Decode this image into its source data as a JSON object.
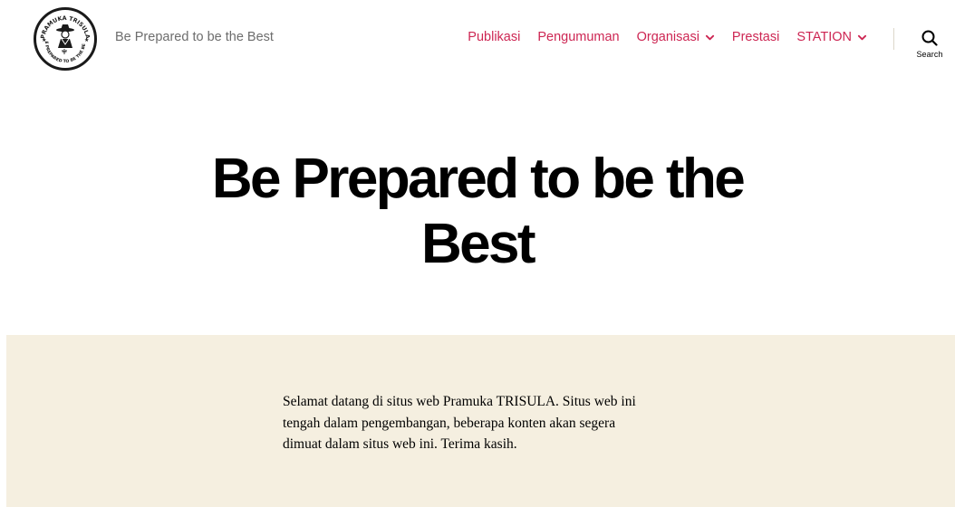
{
  "header": {
    "logo_alt": "Pramuka TRISULA",
    "logo_text_top": "PRAMUKA TRISULA",
    "logo_text_bottom": "BE PREPARED TO BE THE BEST",
    "tagline": "Be Prepared to be the Best",
    "nav": [
      {
        "label": "Publikasi",
        "has_dropdown": false
      },
      {
        "label": "Pengumuman",
        "has_dropdown": false
      },
      {
        "label": "Organisasi",
        "has_dropdown": true
      },
      {
        "label": "Prestasi",
        "has_dropdown": false
      },
      {
        "label": "STATION",
        "has_dropdown": true
      }
    ],
    "search_label": "Search"
  },
  "hero": {
    "title_line1": "Be Prepared to be the",
    "title_line2": "Best"
  },
  "content": {
    "welcome_line1": "Selamat datang di situs web Pramuka TRISULA. Situs web ini",
    "welcome_line2": "tengah dalam pengembangan, beberapa konten akan segera",
    "welcome_line3": "dimuat dalam situs web ini. Terima kasih."
  },
  "colors": {
    "accent": "#cd2653",
    "tagline": "#6d6d6d",
    "band_background": "#f5efe0",
    "separator": "#dcd7ca"
  },
  "icons": {
    "search": "search-icon",
    "dropdown": "chevron-down-icon"
  }
}
